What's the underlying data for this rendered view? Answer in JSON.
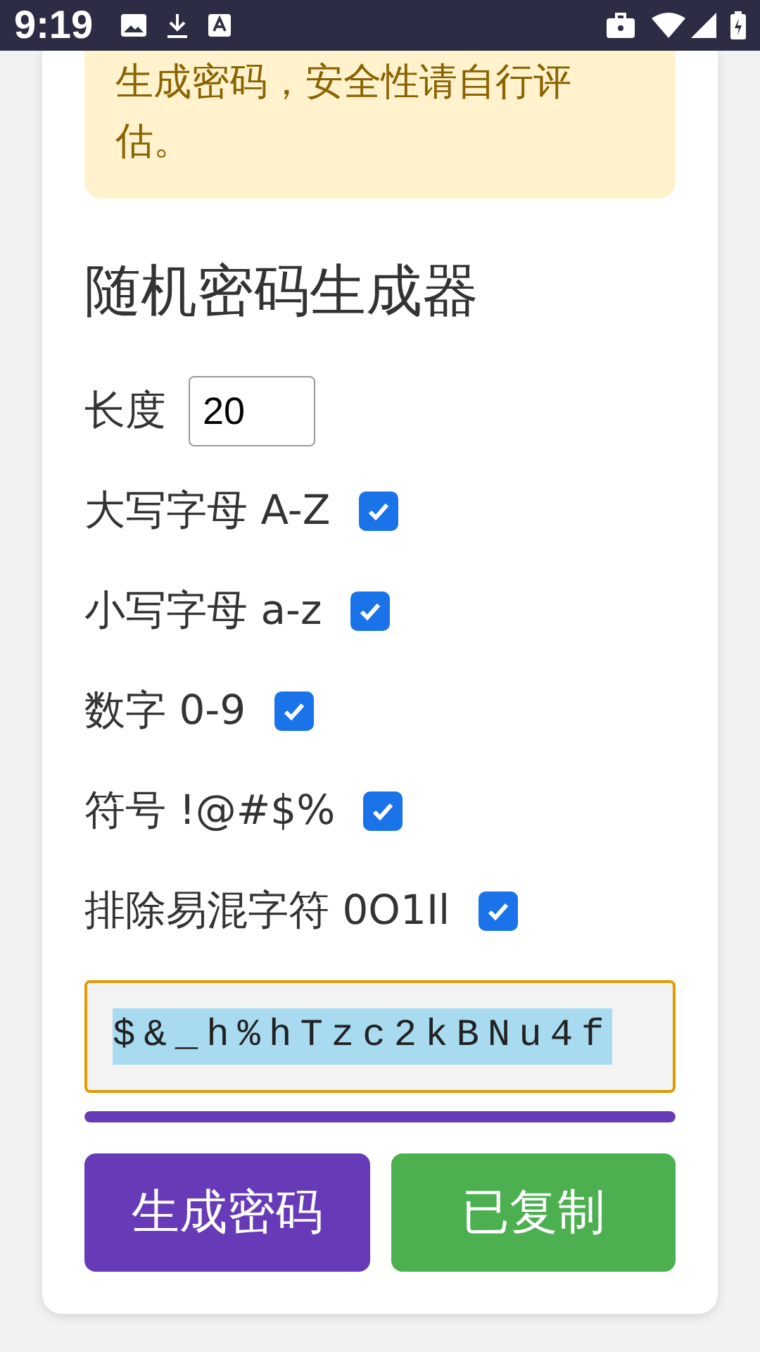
{
  "status_bar": {
    "time": "9:19"
  },
  "notice": {
    "text": "生成密码，安全性请自行评估。"
  },
  "title": "随机密码生成器",
  "length": {
    "label": "长度",
    "value": "20"
  },
  "options": [
    {
      "label": "大写字母 A-Z",
      "checked": true
    },
    {
      "label": "小写字母 a-z",
      "checked": true
    },
    {
      "label": "数字 0-9",
      "checked": true
    },
    {
      "label": "符号 !@#$%",
      "checked": true
    },
    {
      "label": "排除易混字符 0O1Il",
      "checked": true
    }
  ],
  "password": {
    "value": "$&_h%hTzc2kBNu4f",
    "selected": true
  },
  "strength": {
    "level": 1
  },
  "buttons": [
    {
      "label": "生成密码",
      "kind": "primary"
    },
    {
      "label": "已复制",
      "kind": "success"
    }
  ]
}
